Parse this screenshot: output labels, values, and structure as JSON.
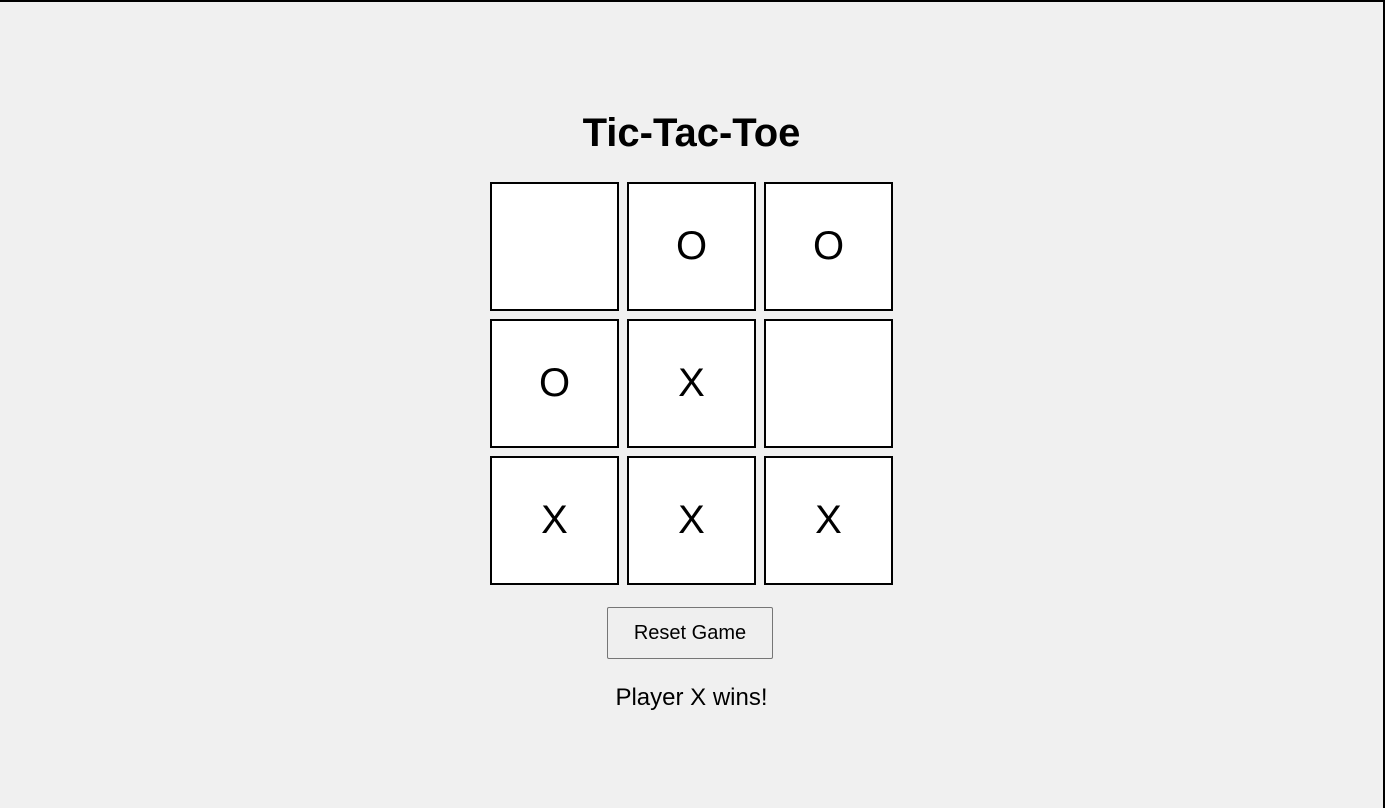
{
  "game": {
    "title": "Tic-Tac-Toe",
    "board": [
      [
        "",
        "O",
        "O"
      ],
      [
        "O",
        "X",
        ""
      ],
      [
        "X",
        "X",
        "X"
      ]
    ],
    "reset_label": "Reset Game",
    "status": "Player X wins!"
  },
  "colors": {
    "background": "#f0f0f0",
    "cell_background": "#ffffff",
    "border": "#000000"
  }
}
